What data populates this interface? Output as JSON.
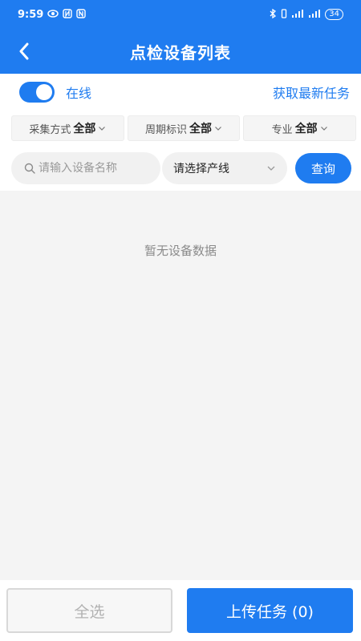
{
  "status_bar": {
    "time": "9:59",
    "left_icons": [
      "eye-icon",
      "nfc-icon",
      "n-badge-icon"
    ],
    "right_icons": [
      "bluetooth-icon",
      "vibrate-icon",
      "signal-icon",
      "signal-4g-icon"
    ],
    "battery": "34"
  },
  "nav": {
    "title": "点检设备列表"
  },
  "toolbar": {
    "online_label": "在线",
    "online_enabled": true,
    "fetch_label": "获取最新任务"
  },
  "filters": [
    {
      "label": "采集方式",
      "value": "全部"
    },
    {
      "label": "周期标识",
      "value": "全部"
    },
    {
      "label": "专业",
      "value": "全部"
    }
  ],
  "search": {
    "placeholder": "请输入设备名称",
    "line_placeholder": "请选择产线",
    "query_label": "查询"
  },
  "list": {
    "empty_text": "暂无设备数据"
  },
  "bottom": {
    "select_all_label": "全选",
    "upload_label": "上传任务 (0)"
  },
  "colors": {
    "primary": "#1f7cf0",
    "background": "#f4f4f4"
  }
}
